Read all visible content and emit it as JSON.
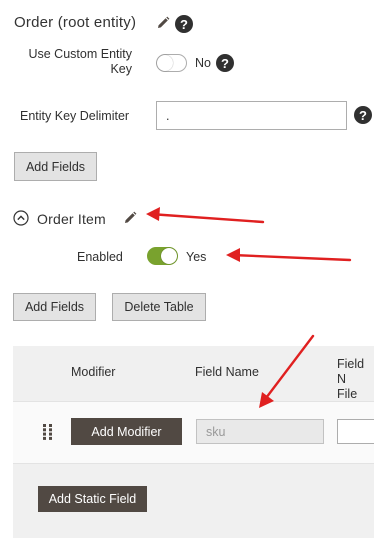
{
  "section_root": {
    "title": "Order (root entity)",
    "edit_icon": "pencil-icon",
    "help_icon": "question-icon",
    "help_symbol": "?"
  },
  "custom_entity_key": {
    "label_line1": "Use Custom Entity",
    "label_line2": "Key",
    "toggle_state": "off",
    "toggle_text": "No"
  },
  "entity_key_delimiter": {
    "label": "Entity Key Delimiter",
    "value": "."
  },
  "buttons": {
    "add_fields_top": "Add Fields",
    "add_fields": "Add Fields",
    "delete_table": "Delete Table",
    "add_modifier": "Add Modifier",
    "add_static_field": "Add Static Field"
  },
  "section_item": {
    "collapse_icon": "chevron-up-circle-icon",
    "title": "Order Item"
  },
  "enabled": {
    "label": "Enabled",
    "toggle_state": "on",
    "toggle_text": "Yes"
  },
  "table": {
    "headers": {
      "modifier": "Modifier",
      "field_name": "Field Name",
      "field_n_line1": "Field N",
      "field_n_line2": "File"
    },
    "row": {
      "field_name_value": "sku"
    }
  },
  "colors": {
    "accent_green": "#79a22e",
    "dark_button": "#514943",
    "arrow_red": "#e02020",
    "panel_bg": "#f0f0f0"
  }
}
